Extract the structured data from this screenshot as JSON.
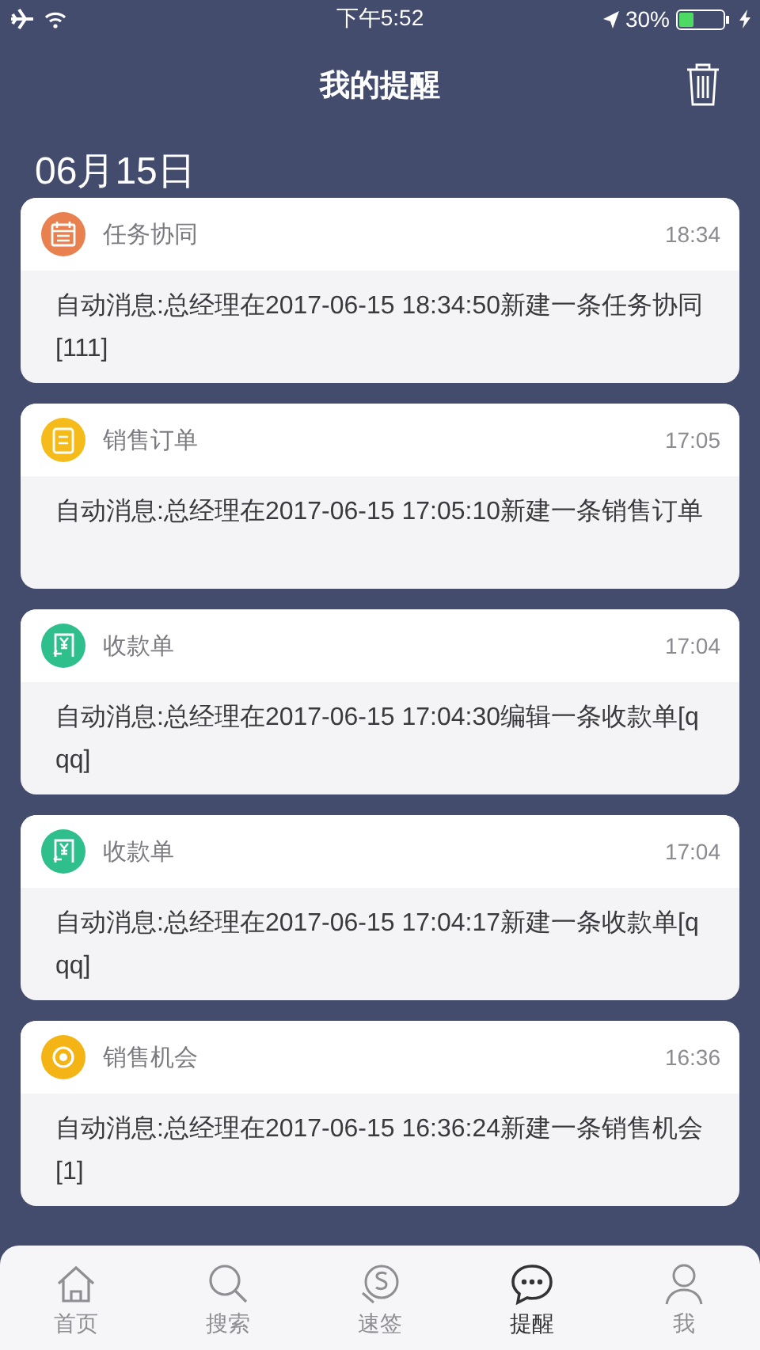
{
  "status_bar": {
    "time": "下午5:52",
    "battery": "30%"
  },
  "header": {
    "title": "我的提醒"
  },
  "date": "06月15日",
  "reminders": [
    {
      "kind": "task",
      "color": "#e8804f",
      "title": "任务协同",
      "time": "18:34",
      "message": "自动消息:总经理在2017-06-15 18:34:50新建一条任务协同[111]"
    },
    {
      "kind": "order",
      "color": "#f5bb1a",
      "title": "销售订单",
      "time": "17:05",
      "message": "自动消息:总经理在2017-06-15 17:05:10新建一条销售订单"
    },
    {
      "kind": "receipt",
      "color": "#2fbf8d",
      "title": "收款单",
      "time": "17:04",
      "message": "自动消息:总经理在2017-06-15 17:04:30编辑一条收款单[qqq]"
    },
    {
      "kind": "receipt",
      "color": "#2fbf8d",
      "title": "收款单",
      "time": "17:04",
      "message": "自动消息:总经理在2017-06-15 17:04:17新建一条收款单[qqq]"
    },
    {
      "kind": "opportunity",
      "color": "#f5b415",
      "title": "销售机会",
      "time": "16:36",
      "message": "自动消息:总经理在2017-06-15 16:36:24新建一条销售机会[1]"
    }
  ],
  "tabs": [
    {
      "kind": "home",
      "label": "首页",
      "selected": false
    },
    {
      "kind": "search",
      "label": "搜索",
      "selected": false
    },
    {
      "kind": "sign",
      "label": "速签",
      "selected": false
    },
    {
      "kind": "chat",
      "label": "提醒",
      "selected": true
    },
    {
      "kind": "user",
      "label": "我",
      "selected": false
    }
  ]
}
